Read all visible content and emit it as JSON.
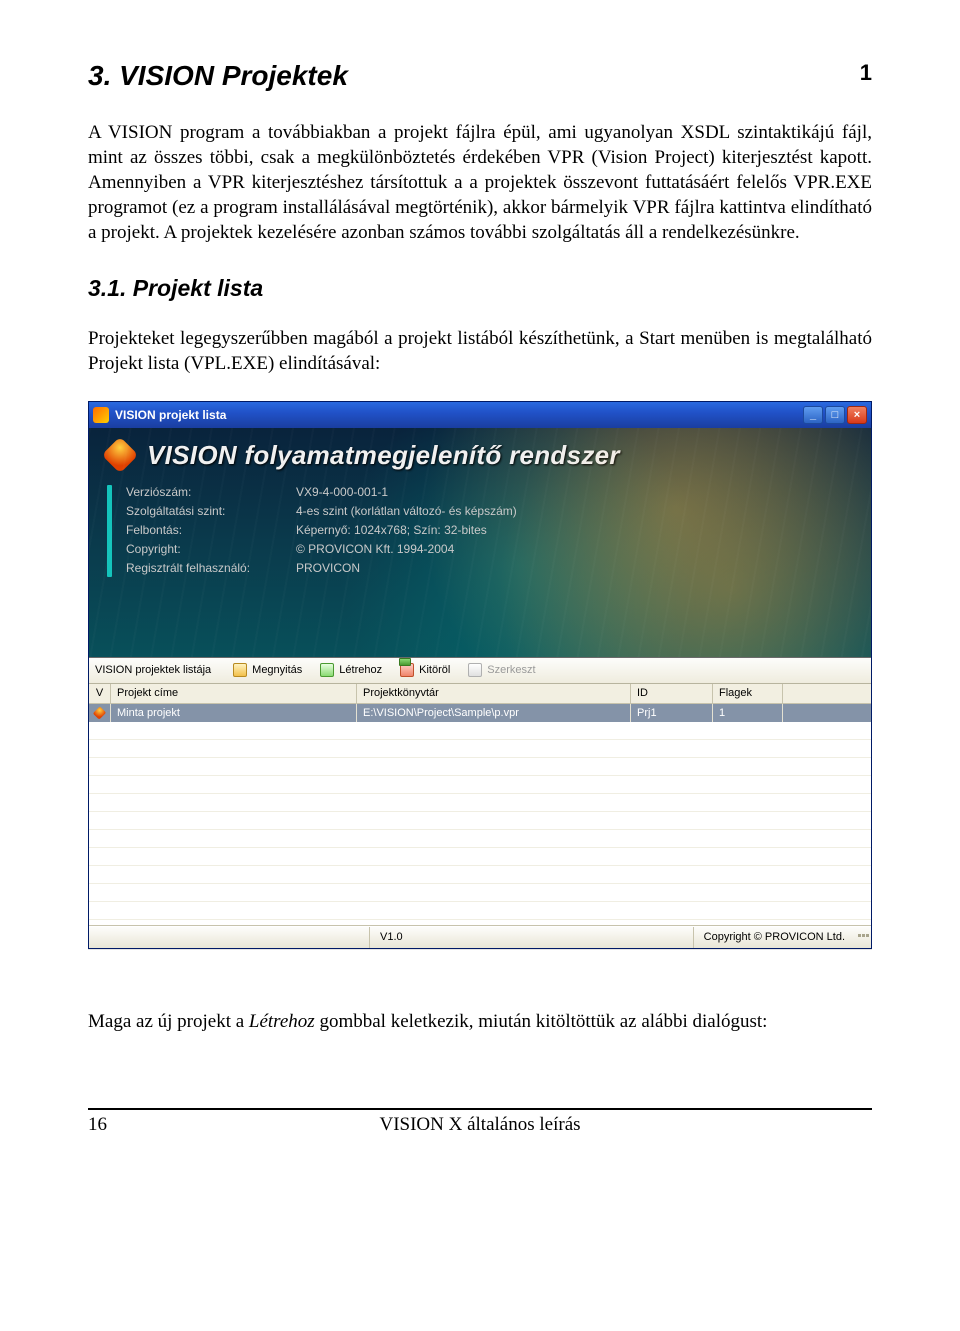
{
  "doc": {
    "heading": "3. VISION Projektek",
    "corner_page": "1",
    "para1": "A VISION program a továbbiakban a projekt fájlra épül, ami ugyanolyan XSDL szintaktikájú fájl, mint az összes többi, csak a megkülönböztetés érdekében VPR (Vision Project) kiterjesztést kapott. Amennyiben a VPR kiterjesztéshez társítottuk a a projektek összevont futtatásáért felelős VPR.EXE programot (ez a program installálásával megtörténik), akkor bármelyik VPR fájlra kattintva elindítható a projekt. A projektek kezelésére azonban számos további szolgáltatás áll a rendelkezésünkre.",
    "subheading": "3.1. Projekt lista",
    "para2": "Projekteket legegyszerűbben magából a projekt listából készíthetünk, a Start menüben is megtalálható Projekt lista (VPL.EXE) elindításával:",
    "after_img": "Maga az új projekt a Létrehoz gombbal keletkezik, miután kitöltöttük az alábbi dialógust:",
    "footer_page": "16",
    "footer_title": "VISION X általános leírás"
  },
  "win": {
    "title": "VISION projekt lista",
    "min": "_",
    "max": "□",
    "close": "×",
    "banner_title": "VISION folyamatmegjelenítő rendszer",
    "info": {
      "l0": "Verziószám:",
      "v0": "VX9-4-000-001-1",
      "l1": "Szolgáltatási szint:",
      "v1": "4-es szint (korlátlan változó- és képszám)",
      "l2": "Felbontás:",
      "v2": "Képernyő: 1024x768; Szín: 32-bites",
      "l3": "Copyright:",
      "v3": "© PROVICON Kft. 1994-2004",
      "l4": "Regisztrált felhasználó:",
      "v4": "PROVICON"
    },
    "toolbar": {
      "label": "VISION projektek listája",
      "open": "Megnyitás",
      "create": "Létrehoz",
      "delete": "Kitöröl",
      "edit": "Szerkeszt"
    },
    "columns": {
      "v": "V",
      "title": "Projekt címe",
      "dir": "Projektkönyvtár",
      "id": "ID",
      "flags": "Flagek"
    },
    "row": {
      "title": "Minta projekt",
      "dir": "E:\\VISION\\Project\\Sample\\p.vpr",
      "id": "Prj1",
      "flags": "1"
    },
    "status": {
      "version": "V1.0",
      "copyright": "Copyright © PROVICON Ltd."
    }
  }
}
